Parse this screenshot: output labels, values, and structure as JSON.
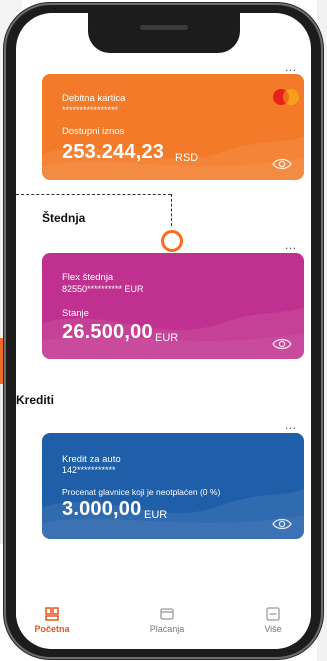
{
  "colors": {
    "accent": "#e8541a",
    "debit_card": "#f27a28",
    "savings_card": "#c0308f",
    "credit_card": "#1f5ea9"
  },
  "debit_card": {
    "more": "...",
    "title": "Debitna kartica",
    "number": "****************",
    "balance_label": "Dostupni iznos",
    "amount": "253.244,23",
    "currency": "RSD"
  },
  "savings": {
    "section_title": "Štednja",
    "more": "...",
    "card": {
      "title": "Flex štednja",
      "number": "82550********** EUR",
      "balance_label": "Stanje",
      "amount": "26.500,00",
      "currency": "EUR"
    }
  },
  "loans": {
    "section_title": "Krediti",
    "more": "...",
    "card": {
      "title": "Kredit za auto",
      "number": "142***********",
      "balance_label": "Procenat glavnice koji je neotplaćen (0 %)",
      "amount": "3.000,00",
      "currency": "EUR"
    }
  },
  "tabbar": {
    "tabs": [
      {
        "label": "Početna",
        "icon": "home-icon",
        "active": true
      },
      {
        "label": "Plaćanja",
        "icon": "wallet-icon",
        "active": false
      },
      {
        "label": "Više",
        "icon": "menu-icon",
        "active": false
      }
    ]
  }
}
